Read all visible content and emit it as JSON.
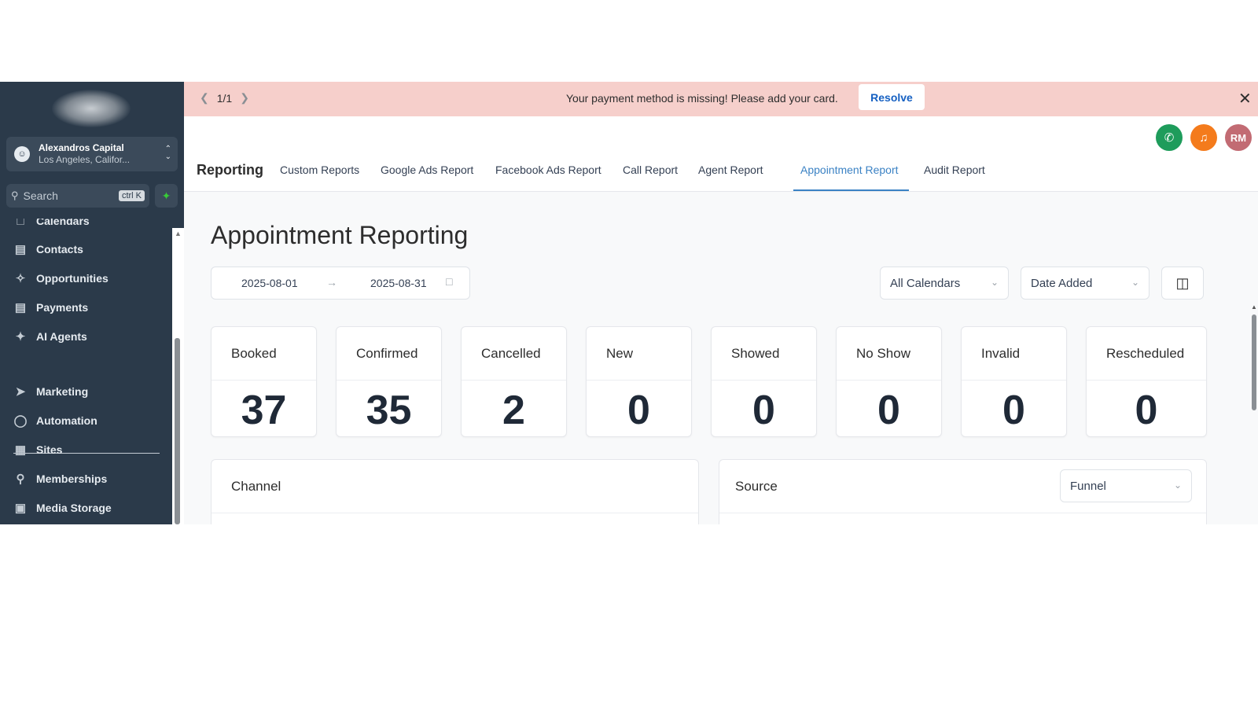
{
  "sidebar": {
    "account": {
      "name": "Alexandros Capital",
      "location": "Los Angeles, Califor..."
    },
    "search": {
      "placeholder": "Search",
      "shortcut": "ctrl K"
    },
    "items": [
      {
        "label": "Calendars",
        "icon": "calendar-icon"
      },
      {
        "label": "Contacts",
        "icon": "contacts-icon"
      },
      {
        "label": "Opportunities",
        "icon": "opportunities-icon"
      },
      {
        "label": "Payments",
        "icon": "payments-icon"
      },
      {
        "label": "AI Agents",
        "icon": "ai-agents-icon"
      },
      {
        "label": "Marketing",
        "icon": "marketing-icon"
      },
      {
        "label": "Automation",
        "icon": "automation-icon"
      },
      {
        "label": "Sites",
        "icon": "sites-icon"
      },
      {
        "label": "Memberships",
        "icon": "memberships-icon"
      },
      {
        "label": "Media Storage",
        "icon": "media-storage-icon"
      }
    ]
  },
  "banner": {
    "pager": "1/1",
    "message": "Your payment method is missing! Please add your card.",
    "action": "Resolve",
    "color": "#f6cfcb"
  },
  "header": {
    "avatar_initials": "RM",
    "phone_color": "#1e9c5b",
    "bell_color": "#f47b1c",
    "avatar_color": "#c26b73"
  },
  "tabs": {
    "title": "Reporting",
    "items": [
      "Custom Reports",
      "Google Ads Report",
      "Facebook Ads Report",
      "Call Report",
      "Agent Report",
      "Appointment Report",
      "Audit Report"
    ],
    "active": "Appointment Report",
    "accent": "#3b82c4"
  },
  "page": {
    "title": "Appointment Reporting",
    "date_start": "2025-08-01",
    "date_end": "2025-08-31",
    "calendar_filter": "All Calendars",
    "date_filter": "Date Added"
  },
  "stats": [
    {
      "label": "Booked",
      "value": "37"
    },
    {
      "label": "Confirmed",
      "value": "35"
    },
    {
      "label": "Cancelled",
      "value": "2"
    },
    {
      "label": "New",
      "value": "0"
    },
    {
      "label": "Showed",
      "value": "0"
    },
    {
      "label": "No Show",
      "value": "0"
    },
    {
      "label": "Invalid",
      "value": "0"
    },
    {
      "label": "Rescheduled",
      "value": "0"
    }
  ],
  "panels": {
    "channel": {
      "title": "Channel"
    },
    "source": {
      "title": "Source",
      "filter": "Funnel"
    }
  }
}
